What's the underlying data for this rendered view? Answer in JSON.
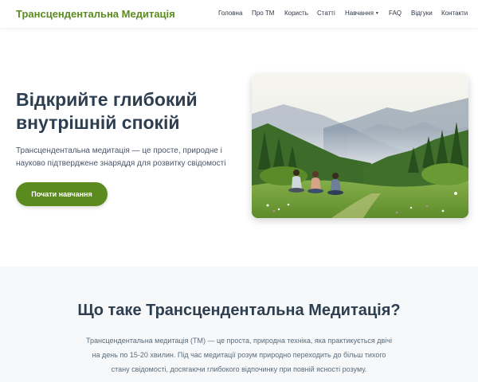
{
  "navbar": {
    "brand": "Трансцендентальна Медитація",
    "items": [
      {
        "label": "Головна"
      },
      {
        "label": "Про ТМ"
      },
      {
        "label": "Користь"
      },
      {
        "label": "Статті"
      },
      {
        "label": "Навчання",
        "dropdown_indicator": "▼"
      },
      {
        "label": "FAQ"
      },
      {
        "label": "Відгуки"
      },
      {
        "label": "Контакти"
      }
    ]
  },
  "hero": {
    "title": "Відкрийте глибокий внутрішній спокій",
    "subtitle": "Трансцендентальна медитація — це просте, природне і науково підтверджене знаряддя для розвитку свідомості",
    "cta_label": "Почати навчання"
  },
  "about": {
    "title": "Що таке Трансцендентальна Медитація?",
    "text": "Трансцендентальна медитація (ТМ) — це проста, природна техніка, яка практикується двічі на день по 15-20 хвилин. Під час медитації розум природно переходить до більш тихого стану свідомості, досягаючи глибокого відпочинку при повній ясності розуму."
  },
  "colors": {
    "brand": "#5b8a1e",
    "heading": "#2c3e50",
    "section_bg": "#f6f8fa"
  }
}
